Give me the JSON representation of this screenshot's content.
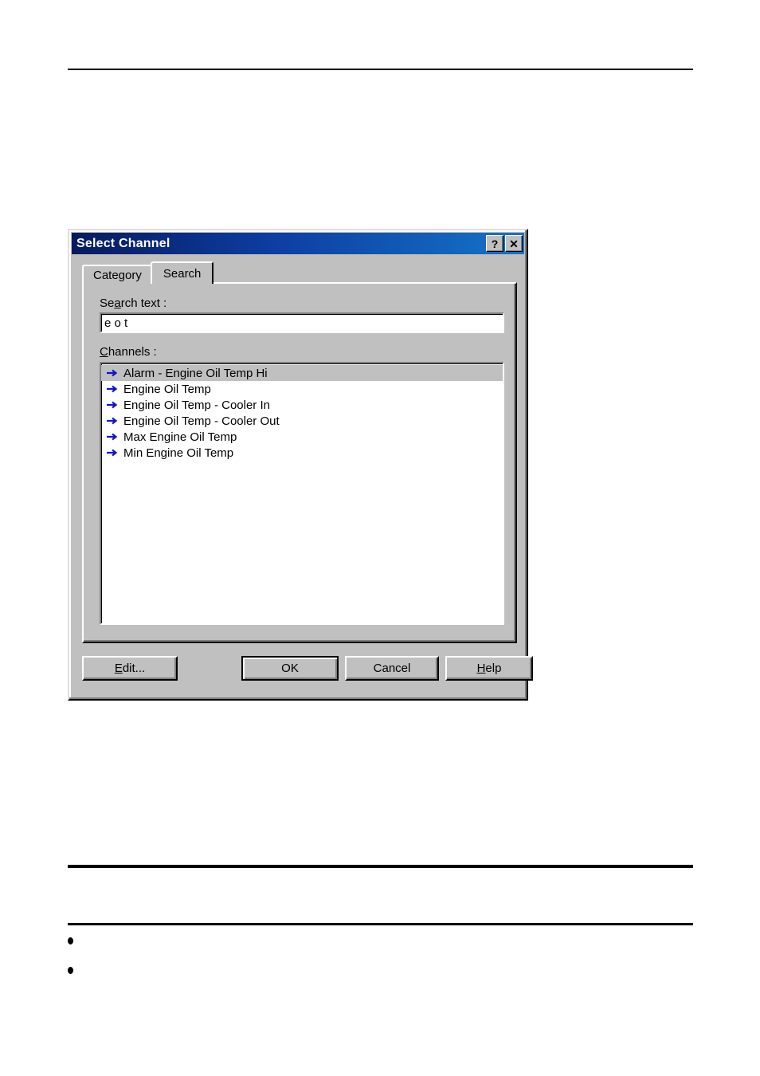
{
  "page": {
    "rules": [
      "top-rule",
      "middle-rule",
      "lower-rule"
    ],
    "bullets": [
      "",
      ""
    ]
  },
  "dialog": {
    "title": "Select Channel",
    "titlebar_buttons": [
      {
        "name": "help-button",
        "glyph": "?"
      },
      {
        "name": "close-button",
        "glyph": "✕"
      }
    ],
    "tabs": [
      {
        "label": "Category",
        "active": false
      },
      {
        "label": "Search",
        "active": true
      }
    ],
    "search": {
      "label_pre": "Se",
      "label_accel": "a",
      "label_post": "rch text :",
      "value": "e o t",
      "placeholder": ""
    },
    "channels": {
      "label_accel": "C",
      "label_post": "hannels :",
      "items": [
        {
          "text": "Alarm - Engine Oil Temp Hi",
          "selected": true
        },
        {
          "text": "Engine Oil Temp",
          "selected": false
        },
        {
          "text": "Engine Oil Temp - Cooler In",
          "selected": false
        },
        {
          "text": "Engine Oil Temp - Cooler Out",
          "selected": false
        },
        {
          "text": "Max Engine Oil Temp",
          "selected": false
        },
        {
          "text": "Min Engine Oil Temp",
          "selected": false
        }
      ],
      "icon": "blue-arrow-icon",
      "icon_color": "#1414c8"
    },
    "buttons": {
      "edit": {
        "pre": "",
        "accel": "E",
        "post": "dit..."
      },
      "ok": {
        "pre": "OK",
        "accel": "",
        "post": ""
      },
      "cancel": {
        "pre": "Cancel",
        "accel": "",
        "post": ""
      },
      "help": {
        "pre": "",
        "accel": "H",
        "post": "elp"
      }
    },
    "colors": {
      "face": "#c0c0c0",
      "title_gradient_start": "#071a5e",
      "title_gradient_end": "#1573c7",
      "selection": "#c0c0c0",
      "accent_arrow": "#1414c8"
    }
  }
}
